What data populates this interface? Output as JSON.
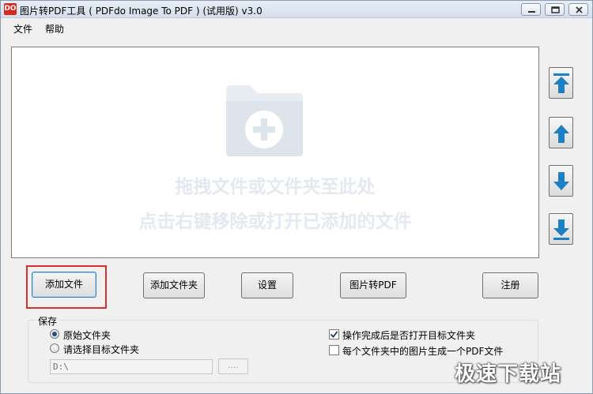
{
  "window": {
    "title": "图片转PDF工具 ( PDFdo Image To PDF ) (试用版) v3.0",
    "icon_text": "DO"
  },
  "menu": [
    "文件",
    "帮助"
  ],
  "dropzone": {
    "hint_line1": "拖拽文件或文件夹至此处",
    "hint_line2": "点击右键移除或打开已添加的文件"
  },
  "side_buttons": [
    {
      "name": "move-to-top",
      "icon": "arrow-to-top-icon"
    },
    {
      "name": "move-up",
      "icon": "arrow-up-icon"
    },
    {
      "name": "move-down",
      "icon": "arrow-down-icon"
    },
    {
      "name": "move-to-bottom",
      "icon": "arrow-to-bottom-icon"
    }
  ],
  "toolbar": {
    "add_file": "添加文件",
    "add_folder": "添加文件夹",
    "settings": "设置",
    "convert": "图片转PDF",
    "register": "注册"
  },
  "save": {
    "group_label": "保存",
    "opt_original": "原始文件夹",
    "opt_choose": "请选择目标文件夹",
    "selected": "原始文件夹",
    "path_value": "D:\\",
    "browse_label": "....",
    "open_after_label": "操作完成后是否打开目标文件夹",
    "open_after_checked": true,
    "one_pdf_label": "每个文件夹中的图片生成一个PDF文件",
    "one_pdf_checked": false
  },
  "watermark": "极速下载站",
  "colors": {
    "accent_arrow": "#1e7fc2",
    "highlight": "#d73030",
    "hint_text": "#e4e9f0"
  }
}
